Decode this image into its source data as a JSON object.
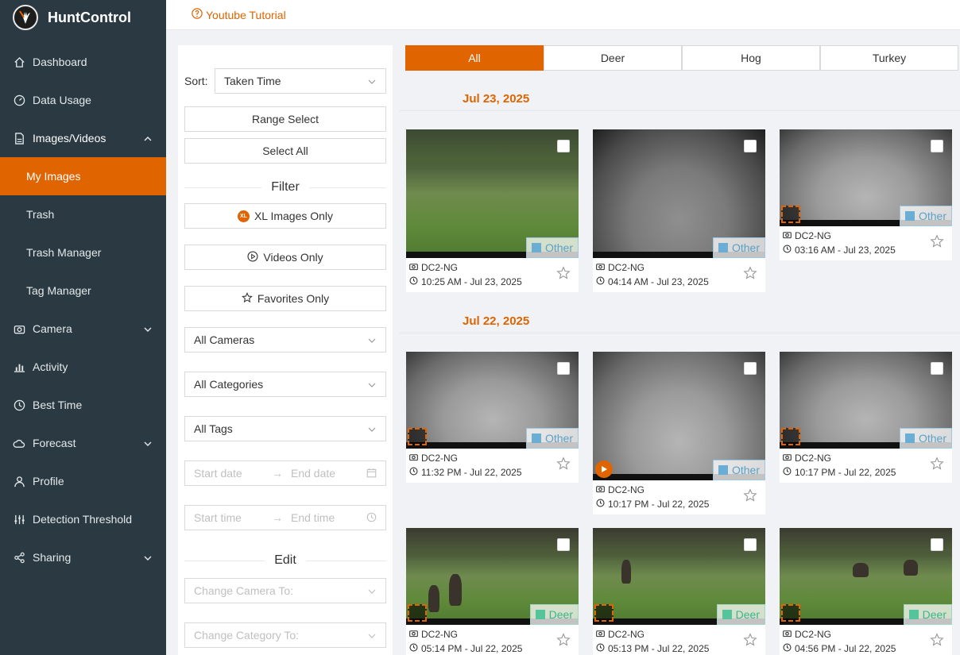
{
  "brand": {
    "name": "HuntControl"
  },
  "nav": [
    {
      "label": "Dashboard",
      "icon": "home-icon"
    },
    {
      "label": "Data Usage",
      "icon": "gauge-icon"
    },
    {
      "label": "Images/Videos",
      "icon": "file-icon"
    },
    {
      "label": "My Images"
    },
    {
      "label": "Trash"
    },
    {
      "label": "Trash Manager"
    },
    {
      "label": "Tag Manager"
    },
    {
      "label": "Camera",
      "icon": "camera-icon"
    },
    {
      "label": "Activity",
      "icon": "chart-icon"
    },
    {
      "label": "Best Time",
      "icon": "clock-icon"
    },
    {
      "label": "Forecast",
      "icon": "cloud-icon"
    },
    {
      "label": "Profile",
      "icon": "user-icon"
    },
    {
      "label": "Detection Threshold",
      "icon": "sliders-icon"
    },
    {
      "label": "Sharing",
      "icon": "share-icon"
    }
  ],
  "topbar": {
    "tutorial_label": "Youtube Tutorial"
  },
  "filter": {
    "sort_label": "Sort:",
    "sort_value": "Taken Time",
    "range_select": "Range Select",
    "select_all": "Select All",
    "filter_title": "Filter",
    "xl_only": "XL Images Only",
    "xl_badge": "XL",
    "videos_only": "Videos Only",
    "favorites_only": "Favorites Only",
    "cameras": "All Cameras",
    "categories": "All Categories",
    "tags": "All Tags",
    "start_date": "Start date",
    "end_date": "End date",
    "start_time": "Start time",
    "end_time": "End time",
    "arrow": "→",
    "edit_title": "Edit",
    "change_camera": "Change Camera To:",
    "change_category": "Change Category To:"
  },
  "tabs": [
    "All",
    "Deer",
    "Hog",
    "Turkey"
  ],
  "groups": [
    {
      "date": "Jul 23, 2025",
      "cards": [
        {
          "camera": "DC2-NG",
          "time": "10:25 AM - Jul 23, 2025",
          "tag": "Other"
        },
        {
          "camera": "DC2-NG",
          "time": "04:14 AM - Jul 23, 2025",
          "tag": "Other"
        },
        {
          "camera": "DC2-NG",
          "time": "03:16 AM - Jul 23, 2025",
          "tag": "Other"
        }
      ]
    },
    {
      "date": "Jul 22, 2025",
      "cards": [
        {
          "camera": "DC2-NG",
          "time": "11:32 PM - Jul 22, 2025",
          "tag": "Other"
        },
        {
          "camera": "DC2-NG",
          "time": "10:17 PM - Jul 22, 2025",
          "tag": "Other"
        },
        {
          "camera": "DC2-NG",
          "time": "10:17 PM - Jul 22, 2025",
          "tag": "Other"
        },
        {
          "camera": "DC2-NG",
          "time": "05:14 PM - Jul 22, 2025",
          "tag": "Deer"
        },
        {
          "camera": "DC2-NG",
          "time": "05:13 PM - Jul 22, 2025",
          "tag": "Deer"
        },
        {
          "camera": "DC2-NG",
          "time": "04:56 PM - Jul 22, 2025",
          "tag": "Deer"
        }
      ]
    }
  ],
  "colors": {
    "accent": "#e06400",
    "sidebar": "#2b3a42",
    "other_tag": "#6aaed6",
    "deer_tag": "#56c49a"
  }
}
